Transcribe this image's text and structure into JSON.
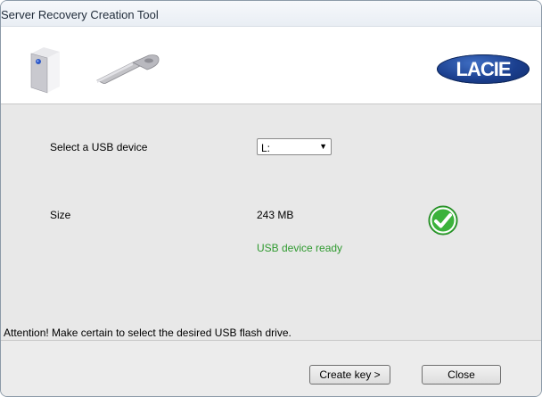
{
  "window": {
    "title": "Server Recovery Creation Tool"
  },
  "banner": {
    "logo_text": "LACIE"
  },
  "form": {
    "usb_label": "Select a USB device",
    "usb_selected": "L:",
    "size_label": "Size",
    "size_value": "243 MB",
    "status_text": "USB device ready",
    "warning": "Attention! Make certain to select the desired USB flash drive."
  },
  "buttons": {
    "create_key": "Create key >",
    "close": "Close"
  },
  "icons": {
    "server": "server-drive-icon",
    "key": "usb-key-icon",
    "status": "checkmark-icon",
    "dropdown": "chevron-down-icon"
  },
  "colors": {
    "status_ready": "#2f9a2f",
    "logo": "#1b3f8e",
    "check": "#3bb23b"
  }
}
